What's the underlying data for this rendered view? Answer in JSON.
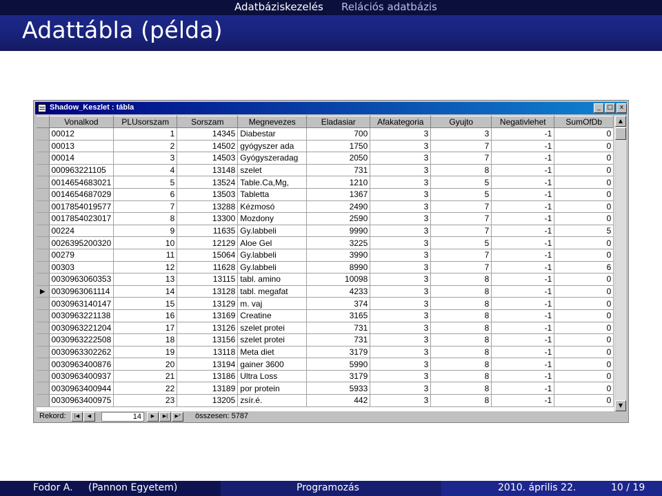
{
  "slide": {
    "nav_section": "Adatbáziskezelés",
    "nav_subsection": "Relációs adatbázis",
    "frame_title": "Adattábla (példa)"
  },
  "window": {
    "title": "Shadow_Keszlet : tábla",
    "buttons": {
      "minimize": "_",
      "restore": "□",
      "close": "x"
    }
  },
  "table": {
    "columns": [
      "Vonalkod",
      "PLUsorszam",
      "Sorszam",
      "Megnevezes",
      "Eladasiar",
      "Afakategoria",
      "Gyujto",
      "Negativlehet",
      "SumOfDb"
    ],
    "current_row_index": 14,
    "rows": [
      [
        "00012",
        "1",
        "14345",
        "Diabestar",
        "700",
        "3",
        "3",
        "-1",
        "0"
      ],
      [
        "00013",
        "2",
        "14502",
        "gyógyszer ada",
        "1750",
        "3",
        "7",
        "-1",
        "0"
      ],
      [
        "00014",
        "3",
        "14503",
        "Gyógyszeradag",
        "2050",
        "3",
        "7",
        "-1",
        "0"
      ],
      [
        "000963221105",
        "4",
        "13148",
        "szelet",
        "731",
        "3",
        "8",
        "-1",
        "0"
      ],
      [
        "0014654683021",
        "5",
        "13524",
        "Table.Ca,Mg,",
        "1210",
        "3",
        "5",
        "-1",
        "0"
      ],
      [
        "0014654687029",
        "6",
        "13503",
        "Tabletta",
        "1367",
        "3",
        "5",
        "-1",
        "0"
      ],
      [
        "0017854019577",
        "7",
        "13288",
        "Kézmosó",
        "2490",
        "3",
        "7",
        "-1",
        "0"
      ],
      [
        "0017854023017",
        "8",
        "13300",
        "Mozdony",
        "2590",
        "3",
        "7",
        "-1",
        "0"
      ],
      [
        "00224",
        "9",
        "11635",
        "Gy.labbeli",
        "9990",
        "3",
        "7",
        "-1",
        "5"
      ],
      [
        "0026395200320",
        "10",
        "12129",
        "Aloe Gel",
        "3225",
        "3",
        "5",
        "-1",
        "0"
      ],
      [
        "00279",
        "11",
        "15064",
        "Gy.labbeli",
        "3990",
        "3",
        "7",
        "-1",
        "0"
      ],
      [
        "00303",
        "12",
        "11628",
        "Gy.labbeli",
        "8990",
        "3",
        "7",
        "-1",
        "6"
      ],
      [
        "0030963060353",
        "13",
        "13115",
        "tabl. amino",
        "10098",
        "3",
        "8",
        "-1",
        "0"
      ],
      [
        "0030963061114",
        "14",
        "13128",
        "tabl. megafat",
        "4233",
        "3",
        "8",
        "-1",
        "0"
      ],
      [
        "0030963140147",
        "15",
        "13129",
        "m. vaj",
        "374",
        "3",
        "8",
        "-1",
        "0"
      ],
      [
        "0030963221138",
        "16",
        "13169",
        "Creatine",
        "3165",
        "3",
        "8",
        "-1",
        "0"
      ],
      [
        "0030963221204",
        "17",
        "13126",
        "szelet protei",
        "731",
        "3",
        "8",
        "-1",
        "0"
      ],
      [
        "0030963222508",
        "18",
        "13156",
        "szelet protei",
        "731",
        "3",
        "8",
        "-1",
        "0"
      ],
      [
        "0030963302262",
        "19",
        "13118",
        "Meta diet",
        "3179",
        "3",
        "8",
        "-1",
        "0"
      ],
      [
        "0030963400876",
        "20",
        "13194",
        "gainer 3600",
        "5990",
        "3",
        "8",
        "-1",
        "0"
      ],
      [
        "0030963400937",
        "21",
        "13186",
        "Ultra Loss",
        "3179",
        "3",
        "8",
        "-1",
        "0"
      ],
      [
        "0030963400944",
        "22",
        "13189",
        "por protein",
        "5933",
        "3",
        "8",
        "-1",
        "0"
      ],
      [
        "0030963400975",
        "23",
        "13205",
        "zsír.é.",
        "442",
        "3",
        "8",
        "-1",
        "0"
      ]
    ]
  },
  "record_nav": {
    "label": "Rekord:",
    "current": "14",
    "total_text": "összesen: 5787"
  },
  "footer": {
    "author": "Fodor A.",
    "institution": "(Pannon Egyetem)",
    "title": "Programozás",
    "date": "2010. április 22.",
    "page": "10 / 19"
  }
}
